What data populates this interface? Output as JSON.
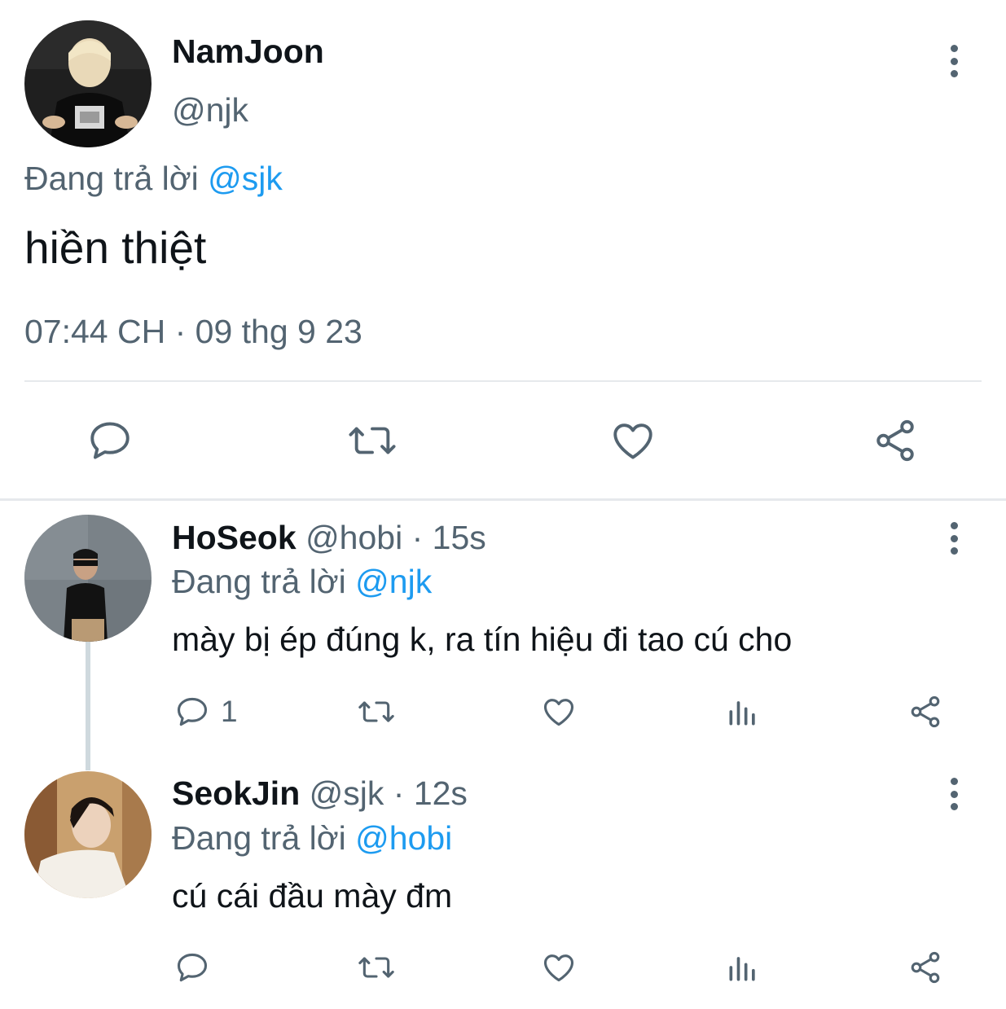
{
  "main_tweet": {
    "display_name": "NamJoon",
    "handle": "@njk",
    "replying_prefix": "Đang trả lời",
    "replying_to": "@sjk",
    "text": "hiền thiệt",
    "timestamp": "07:44 CH · 09 thg 9 23",
    "avatar_icon": "avatar-namjoon",
    "actions": [
      "reply-icon",
      "retweet-icon",
      "like-icon",
      "share-icon"
    ]
  },
  "replies": [
    {
      "display_name": "HoSeok",
      "handle": "@hobi",
      "time": "· 15s",
      "replying_prefix": "Đang trả lời",
      "replying_to": "@njk",
      "text": "mày bị ép đúng k, ra tín hiệu đi tao cú cho",
      "reply_count": "1",
      "avatar_icon": "avatar-hoseok"
    },
    {
      "display_name": "SeokJin",
      "handle": "@sjk",
      "time": "· 12s",
      "replying_prefix": "Đang trả lời",
      "replying_to": "@hobi",
      "text": "cú cái đầu mày đm",
      "reply_count": "",
      "avatar_icon": "avatar-seokjin"
    }
  ],
  "colors": {
    "accent": "#1d9bf0",
    "text": "#0f1419",
    "muted": "#536471",
    "divider": "#e6e9ec"
  }
}
